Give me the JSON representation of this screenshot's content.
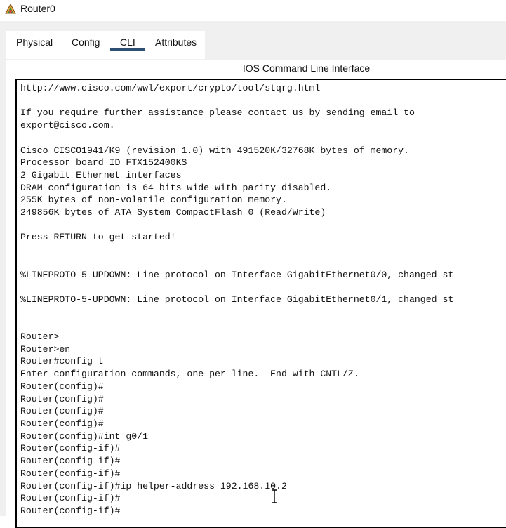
{
  "window": {
    "title": "Router0",
    "icon": "router-device-icon"
  },
  "tabs": [
    {
      "label": "Physical",
      "active": false
    },
    {
      "label": "Config",
      "active": false
    },
    {
      "label": "CLI",
      "active": true
    },
    {
      "label": "Attributes",
      "active": false
    }
  ],
  "cli": {
    "heading": "IOS Command Line Interface",
    "lines": [
      "http://www.cisco.com/wwl/export/crypto/tool/stqrg.html",
      "",
      "If you require further assistance please contact us by sending email to",
      "export@cisco.com.",
      "",
      "Cisco CISCO1941/K9 (revision 1.0) with 491520K/32768K bytes of memory.",
      "Processor board ID FTX152400KS",
      "2 Gigabit Ethernet interfaces",
      "DRAM configuration is 64 bits wide with parity disabled.",
      "255K bytes of non-volatile configuration memory.",
      "249856K bytes of ATA System CompactFlash 0 (Read/Write)",
      "",
      "Press RETURN to get started!",
      "",
      "",
      "%LINEPROTO-5-UPDOWN: Line protocol on Interface GigabitEthernet0/0, changed st",
      "",
      "%LINEPROTO-5-UPDOWN: Line protocol on Interface GigabitEthernet0/1, changed st",
      "",
      "",
      "Router>",
      "Router>en",
      "Router#config t",
      "Enter configuration commands, one per line.  End with CNTL/Z.",
      "Router(config)#",
      "Router(config)#",
      "Router(config)#",
      "Router(config)#",
      "Router(config)#int g0/1",
      "Router(config-if)#",
      "Router(config-if)#",
      "Router(config-if)#",
      "Router(config-if)#ip helper-address 192.168.10.2",
      "Router(config-if)#",
      "Router(config-if)#"
    ]
  },
  "colors": {
    "tab_underline": "#2c4f73",
    "chrome_background": "#f0f0f0"
  }
}
